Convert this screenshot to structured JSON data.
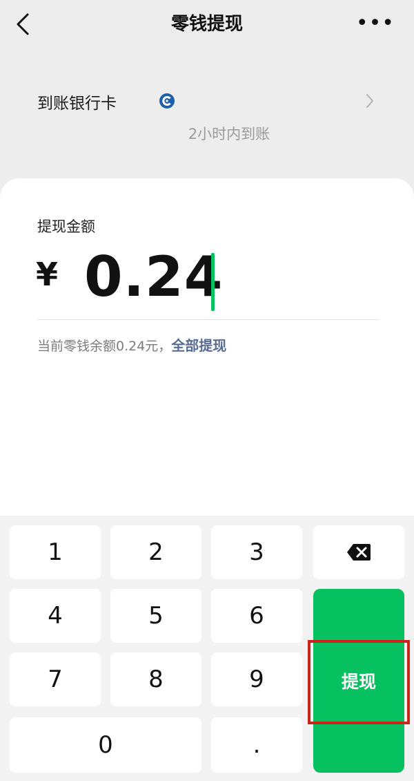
{
  "header": {
    "title": "零钱提现"
  },
  "bank": {
    "label": "到账银行卡",
    "arrival_time": "2小时内到账"
  },
  "amount": {
    "label": "提现金额",
    "currency": "¥",
    "value": "0.24"
  },
  "balance": {
    "text": "当前零钱余额0.24元，",
    "withdraw_all": "全部提现"
  },
  "keypad": {
    "keys": [
      "1",
      "2",
      "3",
      "4",
      "5",
      "6",
      "7",
      "8",
      "9",
      "0",
      "."
    ],
    "submit_label": "提现"
  },
  "colors": {
    "accent": "#07c160",
    "link": "#576b95",
    "highlight": "#c8261b"
  },
  "icons": [
    "back-arrow-icon",
    "more-dots-icon",
    "bank-logo-icon",
    "chevron-right-icon",
    "backspace-icon"
  ]
}
